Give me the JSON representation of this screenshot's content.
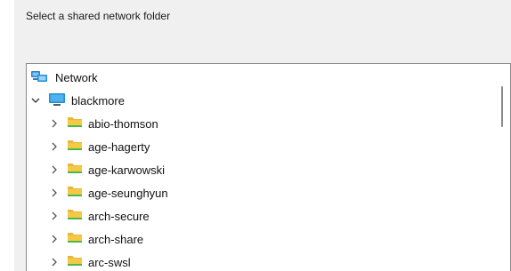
{
  "dialog": {
    "prompt": "Select a shared network folder"
  },
  "tree": {
    "root": {
      "label": "Network",
      "icon": "network-icon"
    },
    "server": {
      "label": "blackmore",
      "icon": "computer-icon",
      "expanded": true
    },
    "folders": [
      {
        "label": "abio-thomson",
        "icon": "folder-icon"
      },
      {
        "label": "age-hagerty",
        "icon": "folder-icon"
      },
      {
        "label": "age-karwowski",
        "icon": "folder-icon"
      },
      {
        "label": "age-seunghyun",
        "icon": "folder-icon"
      },
      {
        "label": "arch-secure",
        "icon": "folder-icon"
      },
      {
        "label": "arch-share",
        "icon": "folder-icon"
      },
      {
        "label": "arc-swsl",
        "icon": "folder-icon"
      }
    ]
  },
  "colors": {
    "dialog_bg": "#f0f0f0",
    "tree_bg": "#ffffff",
    "folder_yellow": "#f6c945",
    "computer_blue": "#1e8fd6"
  }
}
